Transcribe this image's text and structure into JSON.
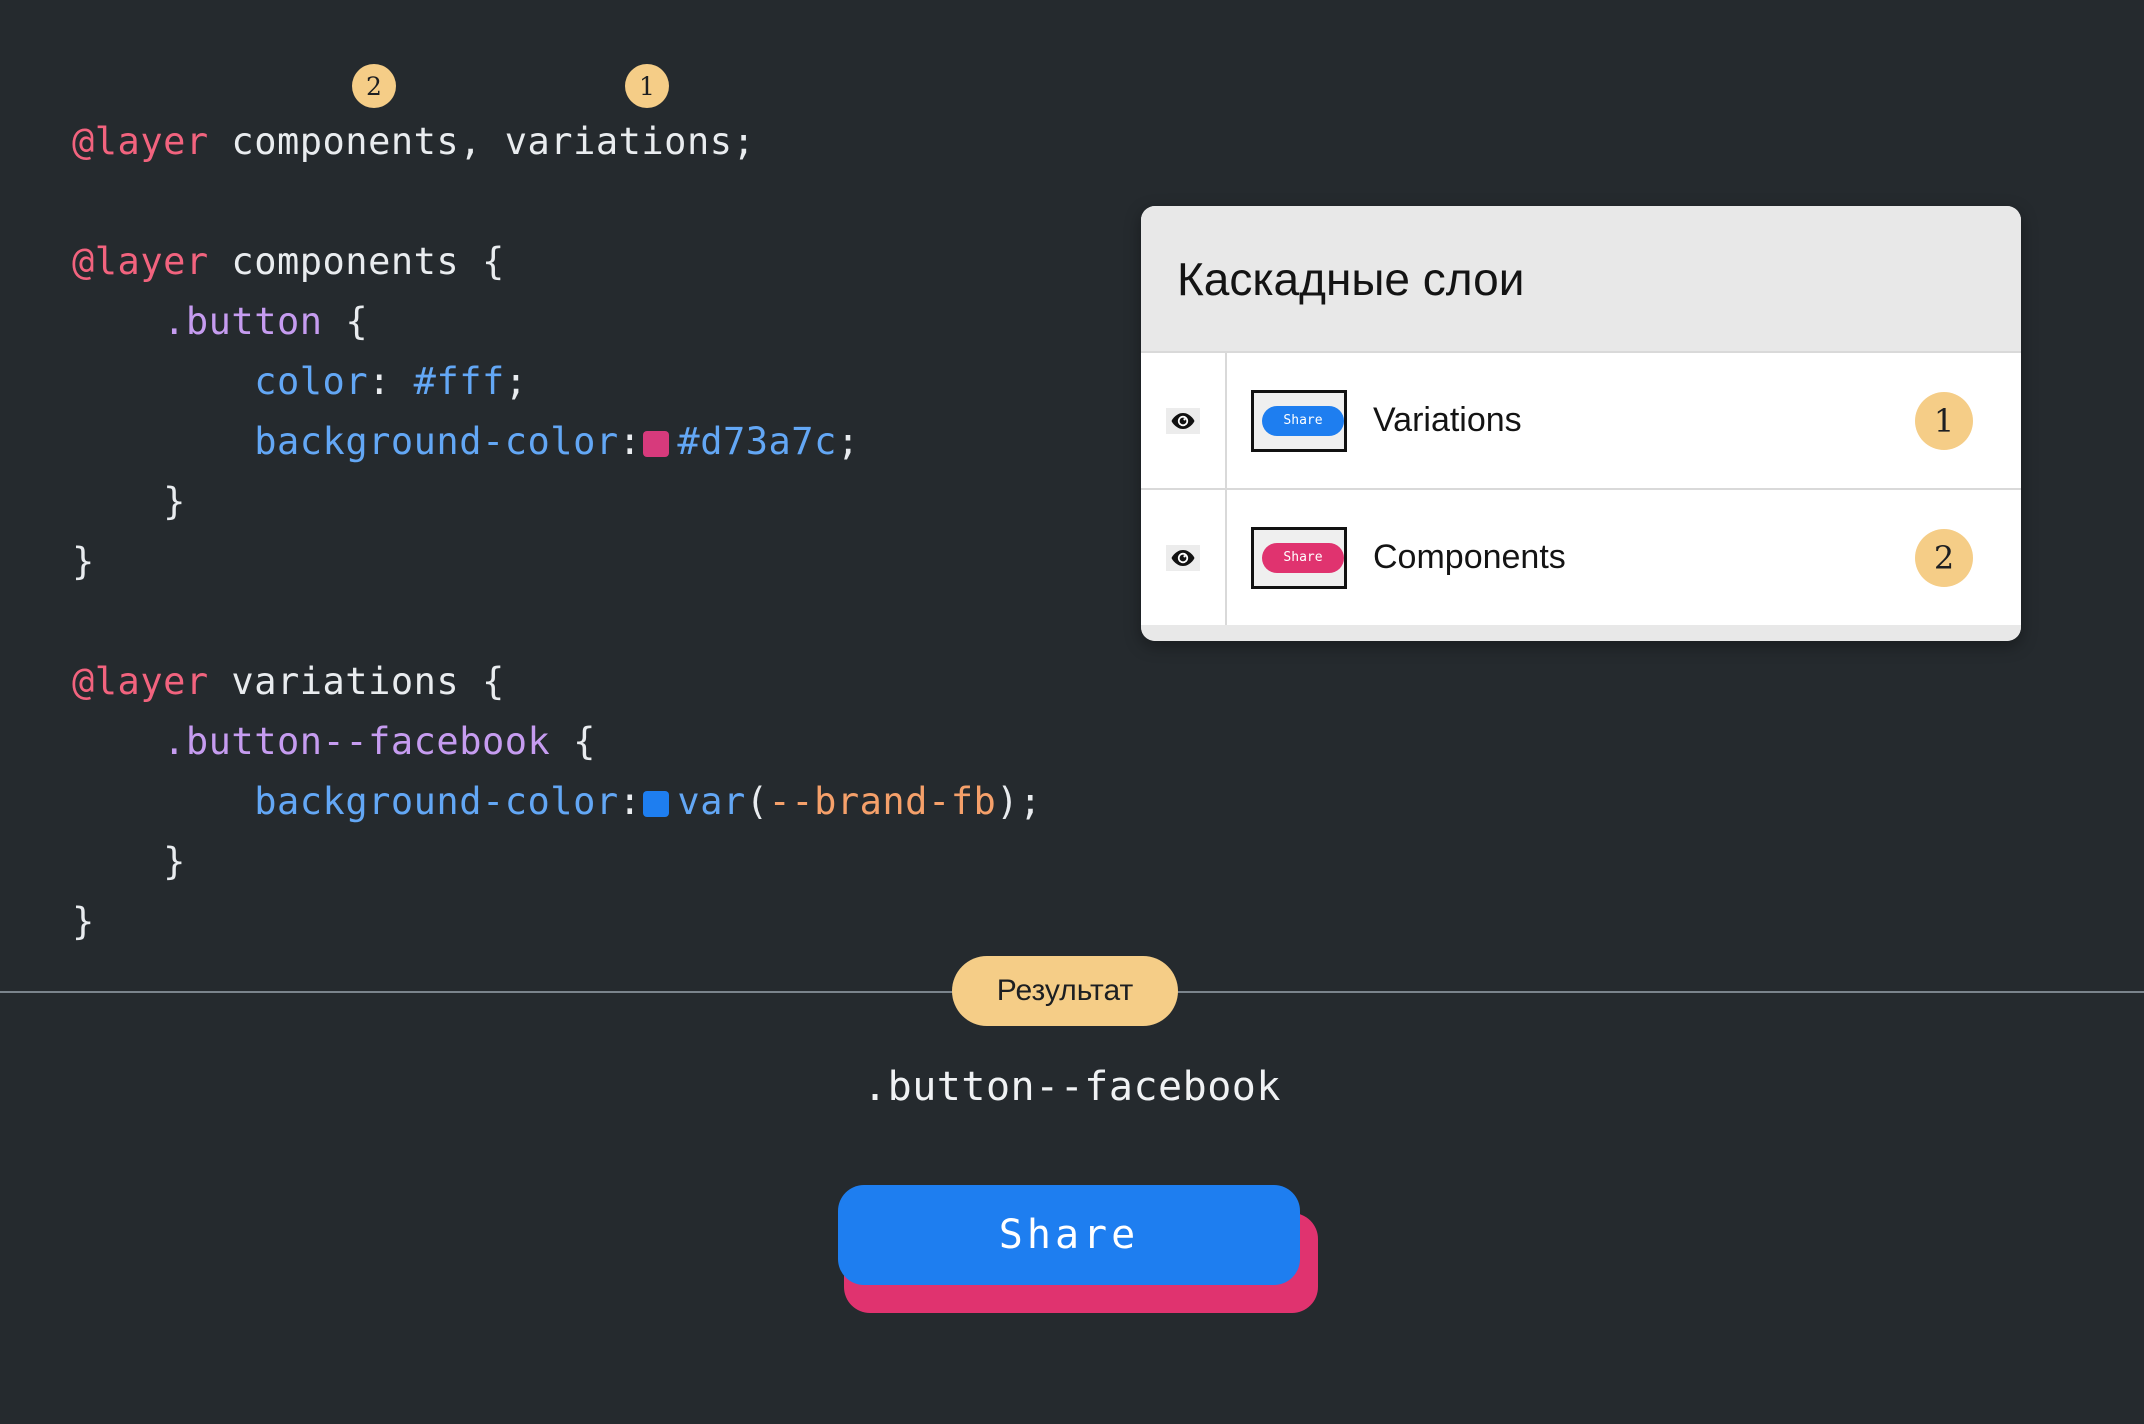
{
  "theme": {
    "background": "#252a2e",
    "accent_amber": "#f5cd87",
    "brand_blue": "#1e7ef0",
    "brand_pink": "#e0336f",
    "code_atrule": "#f2637e",
    "code_selector": "#c69cf0",
    "code_property": "#63a7f5",
    "code_variable": "#f5a06a"
  },
  "code": {
    "badges": [
      {
        "number": "2",
        "for_layer": "components"
      },
      {
        "number": "1",
        "for_layer": "variations"
      }
    ],
    "lines": [
      {
        "segments": [
          {
            "text": "@layer",
            "type": "atrule"
          },
          {
            "text": " components, variations;",
            "type": "plain"
          }
        ]
      },
      {
        "segments": []
      },
      {
        "segments": [
          {
            "text": "@layer",
            "type": "atrule"
          },
          {
            "text": " components {",
            "type": "plain"
          }
        ]
      },
      {
        "segments": [
          {
            "text": "    ",
            "type": "plain"
          },
          {
            "text": ".button",
            "type": "selector"
          },
          {
            "text": " {",
            "type": "plain"
          }
        ]
      },
      {
        "segments": [
          {
            "text": "        ",
            "type": "plain"
          },
          {
            "text": "color",
            "type": "prop"
          },
          {
            "text": ": ",
            "type": "punct"
          },
          {
            "text": "#fff",
            "type": "value"
          },
          {
            "text": ";",
            "type": "punct"
          }
        ]
      },
      {
        "segments": [
          {
            "text": "        ",
            "type": "plain"
          },
          {
            "text": "background-color",
            "type": "prop"
          },
          {
            "text": ":",
            "type": "punct"
          },
          {
            "text": "",
            "type": "swatch",
            "color": "#d73a7c"
          },
          {
            "text": "#d73a7c",
            "type": "value"
          },
          {
            "text": ";",
            "type": "punct"
          }
        ]
      },
      {
        "segments": [
          {
            "text": "    }",
            "type": "plain"
          }
        ]
      },
      {
        "segments": [
          {
            "text": "}",
            "type": "plain"
          }
        ]
      },
      {
        "segments": []
      },
      {
        "segments": [
          {
            "text": "@layer",
            "type": "atrule"
          },
          {
            "text": " variations {",
            "type": "plain"
          }
        ]
      },
      {
        "segments": [
          {
            "text": "    ",
            "type": "plain"
          },
          {
            "text": ".button--facebook",
            "type": "selector"
          },
          {
            "text": " {",
            "type": "plain"
          }
        ]
      },
      {
        "segments": [
          {
            "text": "        ",
            "type": "plain"
          },
          {
            "text": "background-color",
            "type": "prop"
          },
          {
            "text": ":",
            "type": "punct"
          },
          {
            "text": "",
            "type": "swatch",
            "color": "#1e7ef0"
          },
          {
            "text": "var",
            "type": "value"
          },
          {
            "text": "(",
            "type": "punct"
          },
          {
            "text": "--brand-fb",
            "type": "var"
          },
          {
            "text": ")",
            "type": "punct"
          },
          {
            "text": ";",
            "type": "punct"
          }
        ]
      },
      {
        "segments": [
          {
            "text": "    }",
            "type": "plain"
          }
        ]
      },
      {
        "segments": [
          {
            "text": "}",
            "type": "plain"
          }
        ]
      }
    ]
  },
  "layers_panel": {
    "title": "Каскадные слои",
    "rows": [
      {
        "name": "Variations",
        "badge": "1",
        "thumb_label": "Share",
        "thumb_color": "#1e7ef0",
        "visible": true,
        "eye_icon": "eye-icon"
      },
      {
        "name": "Components",
        "badge": "2",
        "thumb_label": "Share",
        "thumb_color": "#e0336f",
        "visible": true,
        "eye_icon": "eye-icon"
      }
    ]
  },
  "result": {
    "pill_label": "Результат",
    "selector_label": ".button--facebook",
    "button_label": "Share",
    "button_color": "#1e7ef0",
    "button_shadow_color": "#e0336f"
  }
}
